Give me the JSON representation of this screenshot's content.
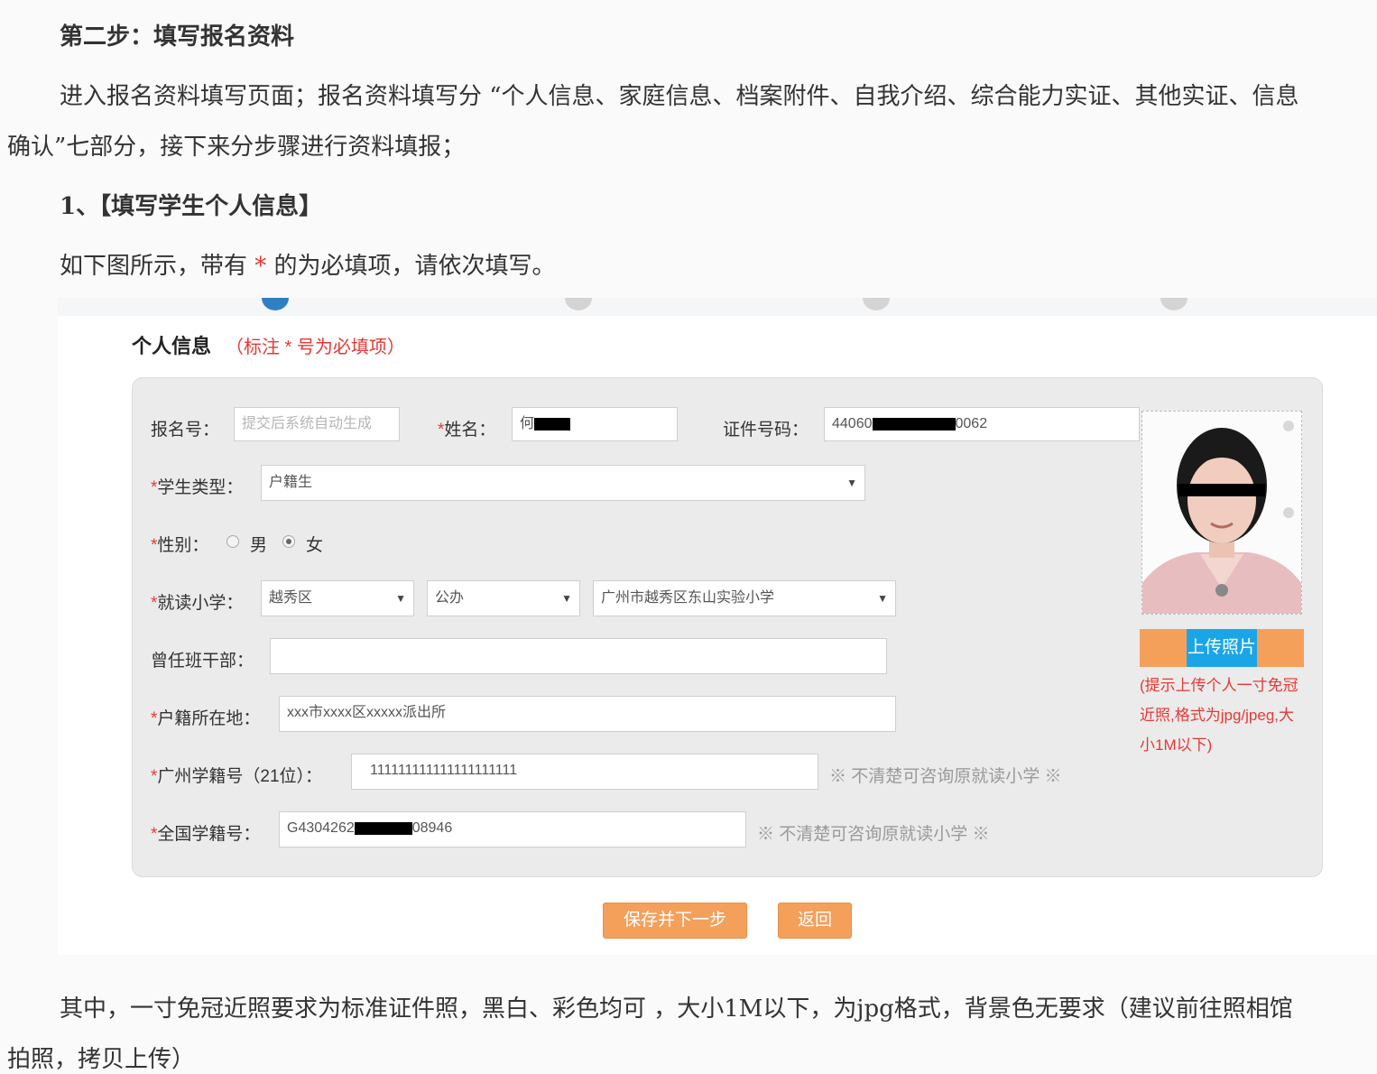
{
  "doc": {
    "step_heading": "第二步：填写报名资料",
    "intro_line1": "进入报名资料填写页面；报名资料填写分 “个人信息、家庭信息、档案附件、自我介绍、综合能力实证、其他实证、信息",
    "intro_line2": "确认”七部分，接下来分步骤进行资料填报；",
    "sub_heading": "1、【填写学生个人信息】",
    "note_prefix": "如下图所示，带有 ",
    "note_star": "*",
    "note_suffix": " 的为必填项，请依次填写。",
    "footer_line1": "其中，一寸免冠近照要求为标准证件照，黑白、彩色均可 ，大小1M以下，为jpg格式，背景色无要求（建议前往照相馆",
    "footer_line2": "拍照，拷贝上传）"
  },
  "form": {
    "section_title": "个人信息",
    "section_hint": "（标注 * 号为必填项）",
    "required_mark": "*",
    "fields": {
      "signup_no": {
        "label": "报名号：",
        "placeholder": "提交后系统自动生成"
      },
      "name": {
        "label": "姓名：",
        "value": "何"
      },
      "id_no": {
        "label": "证件号码：",
        "value_prefix": "44060",
        "value_suffix": "0062"
      },
      "student_type": {
        "label": "学生类型：",
        "value": "户籍生"
      },
      "gender": {
        "label": "性别：",
        "options": [
          "男",
          "女"
        ],
        "selected": "女"
      },
      "school": {
        "label": "就读小学：",
        "district": "越秀区",
        "school_type": "公办",
        "school_name": "广州市越秀区东山实验小学"
      },
      "cadre": {
        "label": "曾任班干部：",
        "value": ""
      },
      "household": {
        "label": "户籍所在地：",
        "value": "xxx市xxxx区xxxxx派出所"
      },
      "gz_student_no": {
        "label": "广州学籍号（21位）：",
        "value": "111111111111111111111",
        "tip": "※ 不清楚可咨询原就读小学 ※"
      },
      "national_student_no": {
        "label": "全国学籍号：",
        "value_prefix": "G4304262",
        "value_suffix": "08946",
        "tip": "※ 不清楚可咨询原就读小学 ※"
      }
    },
    "photo": {
      "upload_label": "上传照片",
      "upload_tip": "(提示上传个人一寸免冠近照,格式为jpg/jpeg,大小1M以下)"
    },
    "buttons": {
      "save_next": "保存并下一步",
      "back": "返回"
    }
  },
  "colors": {
    "accent": "#f4a05b",
    "required": "#e53935",
    "upload": "#1aa6e6",
    "step_active": "#2f7fc4"
  }
}
